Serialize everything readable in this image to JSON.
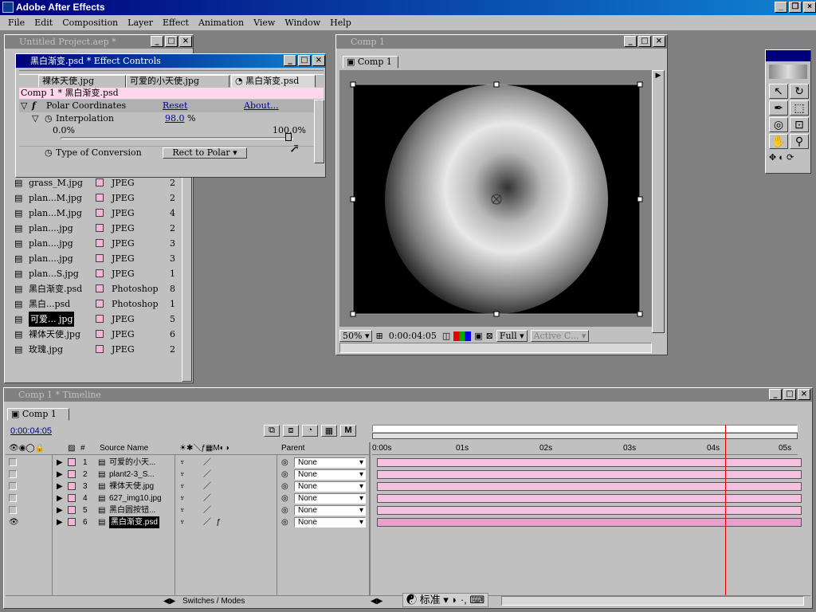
{
  "app": {
    "title": "Adobe After Effects",
    "menu": [
      "File",
      "Edit",
      "Composition",
      "Layer",
      "Effect",
      "Animation",
      "View",
      "Window",
      "Help"
    ]
  },
  "project": {
    "title": "Untitled Project.aep *",
    "items": [
      {
        "name": "grass_M.jpg",
        "type": "JPEG",
        "size": "2"
      },
      {
        "name": "plan...M.jpg",
        "type": "JPEG",
        "size": "2"
      },
      {
        "name": "plan...M.jpg",
        "type": "JPEG",
        "size": "4"
      },
      {
        "name": "plan....jpg",
        "type": "JPEG",
        "size": "2"
      },
      {
        "name": "plan....jpg",
        "type": "JPEG",
        "size": "3"
      },
      {
        "name": "plan....jpg",
        "type": "JPEG",
        "size": "3"
      },
      {
        "name": "plan...S.jpg",
        "type": "JPEG",
        "size": "1"
      },
      {
        "name": "黑白渐变.psd",
        "type": "Photoshop",
        "size": "8"
      },
      {
        "name": "黑白...psd",
        "type": "Photoshop",
        "size": "1"
      },
      {
        "name": "可爱... jpg",
        "type": "JPEG",
        "size": "5"
      },
      {
        "name": "裸体天使.jpg",
        "type": "JPEG",
        "size": "6"
      },
      {
        "name": "玫瑰.jpg",
        "type": "JPEG",
        "size": "2"
      }
    ]
  },
  "effect_controls": {
    "title": "黑白渐变.psd * Effect Controls",
    "tabs": [
      "裸体天使.jpg",
      "可爱的小天使.jpg",
      "黑白渐变.psd"
    ],
    "breadcrumb": "Comp 1 * 黑白渐变.psd",
    "effect_name": "Polar Coordinates",
    "reset": "Reset",
    "about": "About...",
    "interpolation_label": "Interpolation",
    "interpolation_value": "98.0",
    "interpolation_unit": "%",
    "interpolation_fraction": 0.98,
    "slider_min": "0.0%",
    "slider_max": "100.0%",
    "conversion_label": "Type of Conversion",
    "conversion_value": "Rect to Polar"
  },
  "comp": {
    "title": "Comp 1",
    "tab": "Comp 1",
    "zoom": "50%",
    "timecode": "0:00:04:05",
    "resolution": "Full",
    "camera": "Active C..."
  },
  "timeline": {
    "title": "Comp 1 * Timeline",
    "tab": "Comp 1",
    "timecode": "0:00:04:05",
    "col_source": "Source Name",
    "col_parent": "Parent",
    "ruler": [
      "0:00s",
      "01s",
      "02s",
      "03s",
      "04s",
      "05s"
    ],
    "current_time_fraction": 0.83,
    "switches_label": "Switches / Modes",
    "layers": [
      {
        "num": "1",
        "name": "可爱的小天...",
        "parent": "None"
      },
      {
        "num": "2",
        "name": "plant2-3_S...",
        "parent": "None"
      },
      {
        "num": "3",
        "name": "裸体天使.jpg",
        "parent": "None"
      },
      {
        "num": "4",
        "name": "627_img10.jpg",
        "parent": "None"
      },
      {
        "num": "5",
        "name": "黑白圆按钮...",
        "parent": "None"
      },
      {
        "num": "6",
        "name": "黑白渐变.psd",
        "parent": "None"
      }
    ]
  },
  "ime": {
    "label": "标准"
  }
}
